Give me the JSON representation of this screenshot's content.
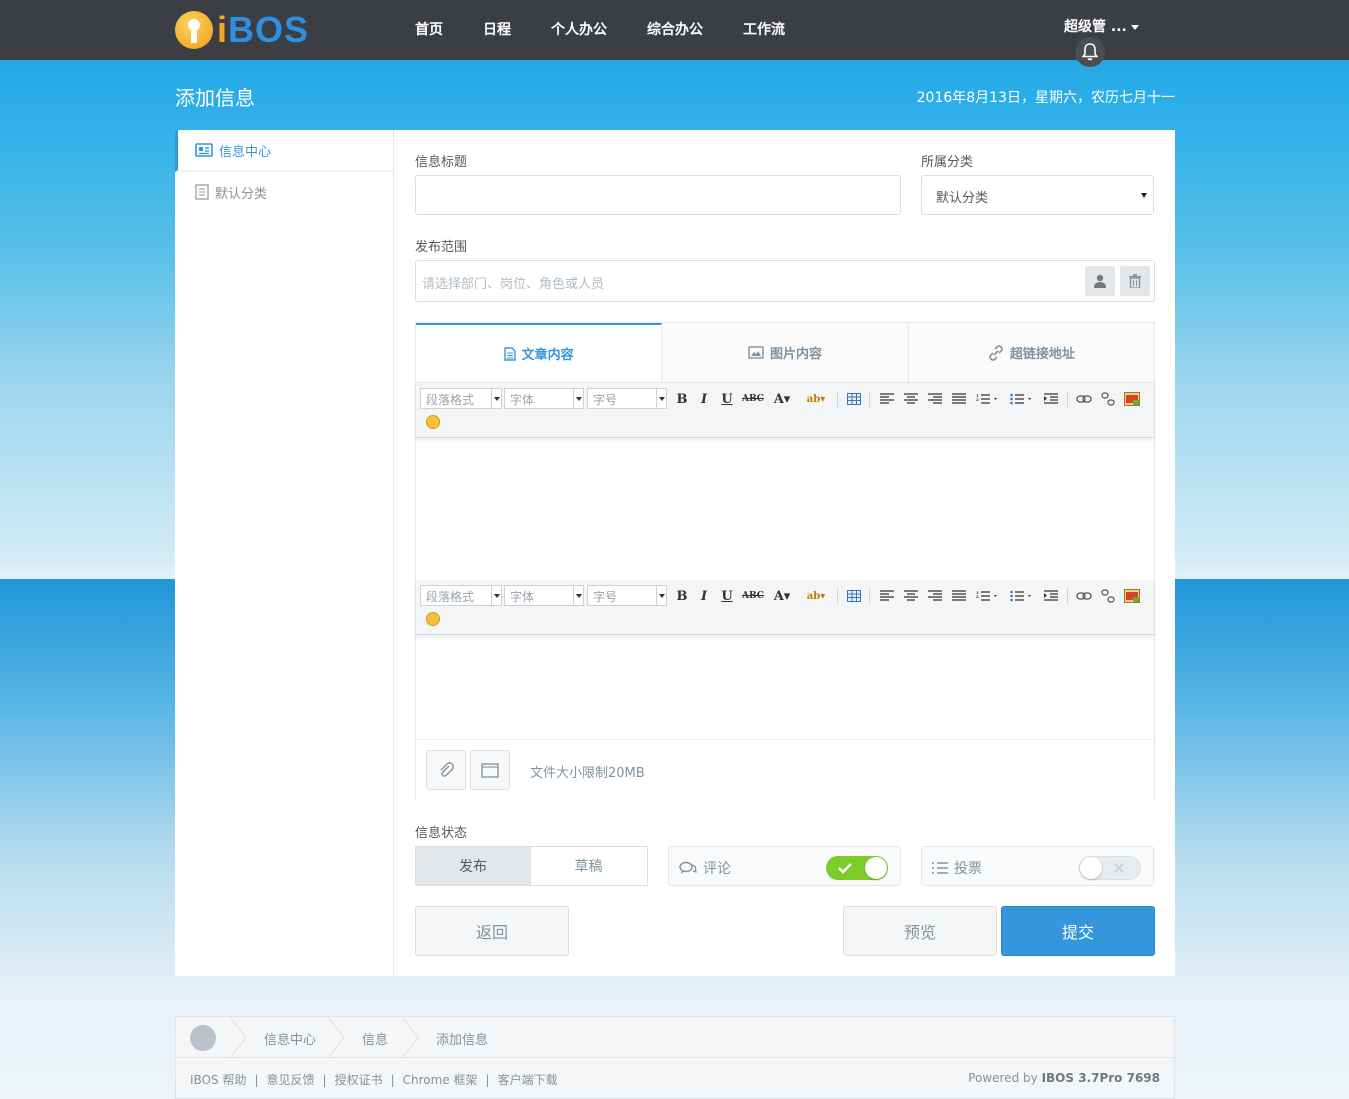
{
  "topbar": {
    "logo_text_i": "i",
    "logo_text_rest": "BOS",
    "nav": [
      "首页",
      "日程",
      "个人办公",
      "综合办公",
      "工作流"
    ],
    "user_name": "超级管 ..."
  },
  "header": {
    "title": "添加信息",
    "date": "2016年8月13日，星期六，农历七月十一"
  },
  "sidebar": {
    "items": [
      {
        "label": "信息中心",
        "icon": "news-icon",
        "active": true
      },
      {
        "label": "默认分类",
        "icon": "category-icon",
        "active": false
      }
    ]
  },
  "form": {
    "title_label": "信息标题",
    "title_value": "",
    "category_label": "所属分类",
    "category_value": "默认分类",
    "scope_label": "发布范围",
    "scope_placeholder": "请选择部门、岗位、角色或人员",
    "tabs": [
      "文章内容",
      "图片内容",
      "超链接地址"
    ],
    "toolbar": {
      "paragraph": "段落格式",
      "font": "字体",
      "size": "字号"
    },
    "upload_note": "文件大小限制20MB",
    "status_label": "信息状态",
    "status_options": [
      "发布",
      "草稿"
    ],
    "comment_label": "评论",
    "comment_on": true,
    "vote_label": "投票",
    "vote_on": false,
    "back_button": "返回",
    "preview_button": "预览",
    "submit_button": "提交"
  },
  "colors": {
    "accent": "#3497db",
    "toggle_on": "#7ccd2a",
    "topbar": "#3b3e43"
  },
  "footer": {
    "breadcrumbs": [
      "信息中心",
      "信息",
      "添加信息"
    ],
    "links": [
      "IBOS 帮助",
      "意见反馈",
      "授权证书",
      "Chrome 框架",
      "客户端下载"
    ],
    "powered_prefix": "Powered by",
    "powered_brand": "IBOS 3.7Pro 7698"
  }
}
